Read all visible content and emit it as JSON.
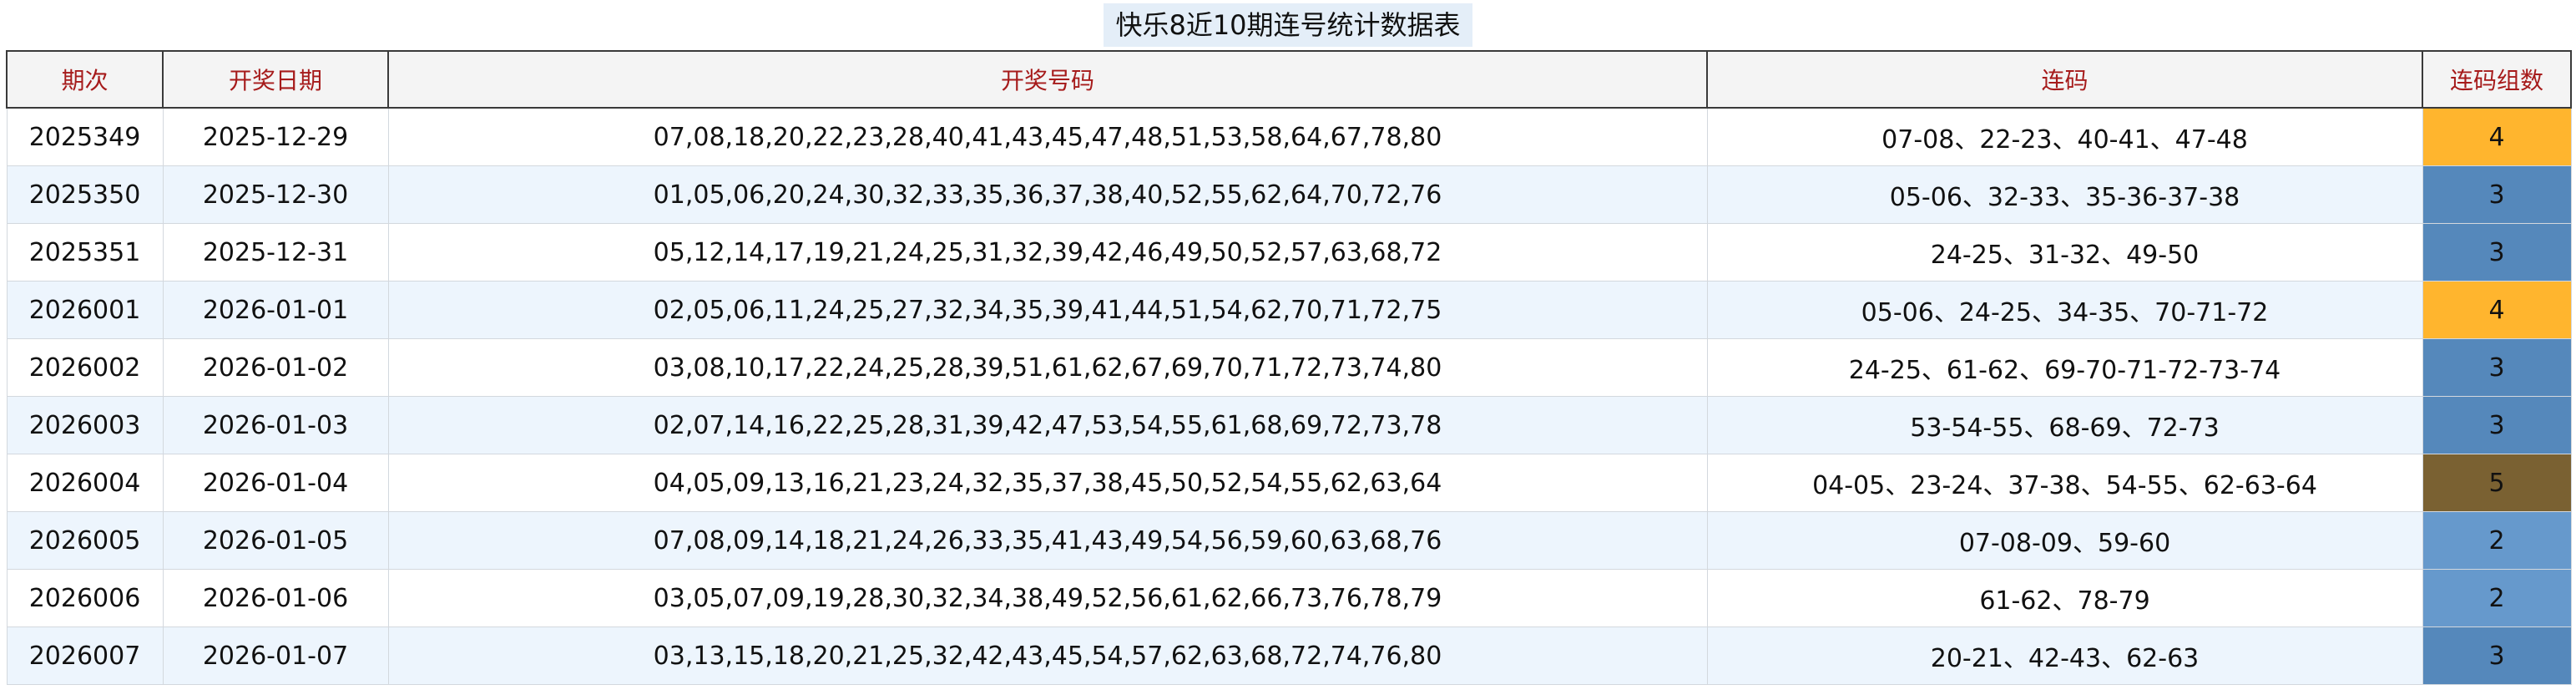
{
  "title": "快乐8近10期连号统计数据表",
  "headers": [
    "期次",
    "开奖日期",
    "开奖号码",
    "连码",
    "连码组数"
  ],
  "count_colors": {
    "2": "#6699cc",
    "3": "#5588bb",
    "4": "#ffb52e",
    "5": "#7a6132"
  },
  "rows": [
    {
      "issue": "2025349",
      "date": "2025-12-29",
      "numbers": "07,08,18,20,22,23,28,40,41,43,45,47,48,51,53,58,64,67,78,80",
      "consecutive": "07-08、22-23、40-41、47-48",
      "count": "4"
    },
    {
      "issue": "2025350",
      "date": "2025-12-30",
      "numbers": "01,05,06,20,24,30,32,33,35,36,37,38,40,52,55,62,64,70,72,76",
      "consecutive": "05-06、32-33、35-36-37-38",
      "count": "3"
    },
    {
      "issue": "2025351",
      "date": "2025-12-31",
      "numbers": "05,12,14,17,19,21,24,25,31,32,39,42,46,49,50,52,57,63,68,72",
      "consecutive": "24-25、31-32、49-50",
      "count": "3"
    },
    {
      "issue": "2026001",
      "date": "2026-01-01",
      "numbers": "02,05,06,11,24,25,27,32,34,35,39,41,44,51,54,62,70,71,72,75",
      "consecutive": "05-06、24-25、34-35、70-71-72",
      "count": "4"
    },
    {
      "issue": "2026002",
      "date": "2026-01-02",
      "numbers": "03,08,10,17,22,24,25,28,39,51,61,62,67,69,70,71,72,73,74,80",
      "consecutive": "24-25、61-62、69-70-71-72-73-74",
      "count": "3"
    },
    {
      "issue": "2026003",
      "date": "2026-01-03",
      "numbers": "02,07,14,16,22,25,28,31,39,42,47,53,54,55,61,68,69,72,73,78",
      "consecutive": "53-54-55、68-69、72-73",
      "count": "3"
    },
    {
      "issue": "2026004",
      "date": "2026-01-04",
      "numbers": "04,05,09,13,16,21,23,24,32,35,37,38,45,50,52,54,55,62,63,64",
      "consecutive": "04-05、23-24、37-38、54-55、62-63-64",
      "count": "5"
    },
    {
      "issue": "2026005",
      "date": "2026-01-05",
      "numbers": "07,08,09,14,18,21,24,26,33,35,41,43,49,54,56,59,60,63,68,76",
      "consecutive": "07-08-09、59-60",
      "count": "2"
    },
    {
      "issue": "2026006",
      "date": "2026-01-06",
      "numbers": "03,05,07,09,19,28,30,32,34,38,49,52,56,61,62,66,73,76,78,79",
      "consecutive": "61-62、78-79",
      "count": "2"
    },
    {
      "issue": "2026007",
      "date": "2026-01-07",
      "numbers": "03,13,15,18,20,21,25,32,42,43,45,54,57,62,63,68,72,74,76,80",
      "consecutive": "20-21、42-43、62-63",
      "count": "3"
    }
  ]
}
